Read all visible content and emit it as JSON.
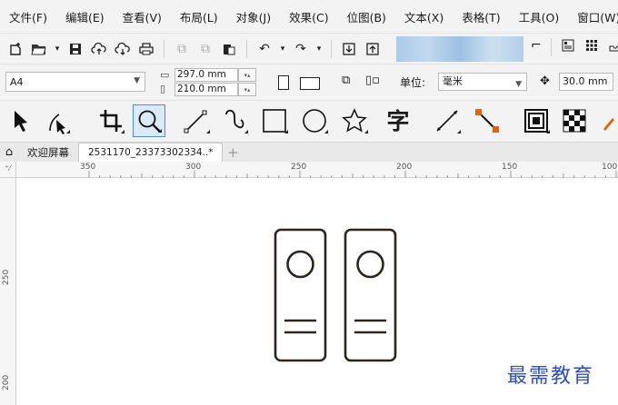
{
  "menu": [
    "文件(F)",
    "编辑(E)",
    "查看(V)",
    "布局(L)",
    "对象(J)",
    "效果(C)",
    "位图(B)",
    "文本(X)",
    "表格(T)",
    "工具(O)",
    "窗口(W)"
  ],
  "property_bar": {
    "page_size": "A4",
    "width": "297.0 mm",
    "height": "210.0 mm",
    "units_label": "单位:",
    "units_value": "毫米",
    "nudge": "30.0 mm"
  },
  "toolbox": {
    "text_tool_char": "字"
  },
  "tabs": {
    "welcome": "欢迎屏幕",
    "document": "2531170_23373302334..*",
    "add": "+"
  },
  "ruler": {
    "top_ticks": [
      "350",
      "300",
      "250",
      "200",
      "150",
      "100"
    ],
    "left_ticks": [
      "250",
      "200"
    ],
    "corner": "⁺⁄"
  },
  "watermark": "最需教育",
  "icons": [
    "new-document-icon",
    "open-folder-icon",
    "save-icon",
    "cloud-upload-icon",
    "cloud-download-icon",
    "print-icon",
    "undo-icon",
    "redo-icon",
    "import-icon",
    "export-icon",
    "pick-tool-icon",
    "shape-tool-icon",
    "crop-tool-icon",
    "zoom-tool-icon",
    "freehand-tool-icon",
    "artistic-media-icon",
    "rectangle-tool-icon",
    "ellipse-tool-icon",
    "polygon-tool-icon",
    "text-tool-icon",
    "dimension-tool-icon",
    "connector-tool-icon",
    "drop-shadow-tool-icon",
    "transparency-tool-icon"
  ]
}
